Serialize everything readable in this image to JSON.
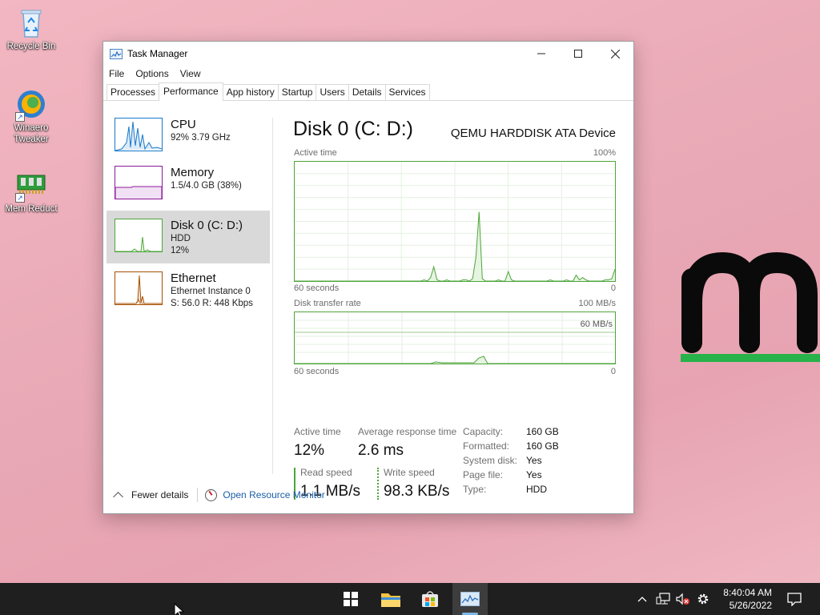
{
  "desktop": {
    "icons": [
      {
        "label": "Recycle Bin"
      },
      {
        "label": "Winaero Tweaker"
      },
      {
        "label": "Mem Reduct"
      }
    ]
  },
  "window": {
    "title": "Task Manager",
    "menu": [
      "File",
      "Options",
      "View"
    ],
    "tabs": [
      "Processes",
      "Performance",
      "App history",
      "Startup",
      "Users",
      "Details",
      "Services"
    ],
    "active_tab": "Performance"
  },
  "sidebar": {
    "items": [
      {
        "title": "CPU",
        "line1": "92%  3.79 GHz",
        "line2": "",
        "color": "#1979c9"
      },
      {
        "title": "Memory",
        "line1": "1.5/4.0 GB (38%)",
        "line2": "",
        "color": "#8b1a9c"
      },
      {
        "title": "Disk 0 (C: D:)",
        "line1": "HDD",
        "line2": "12%",
        "color": "#4da53a",
        "selected": true
      },
      {
        "title": "Ethernet",
        "line1": "Ethernet Instance 0",
        "line2": "S: 56.0  R: 448 Kbps",
        "color": "#a74f01"
      }
    ]
  },
  "detail": {
    "title": "Disk 0 (C: D:)",
    "device": "QEMU HARDDISK ATA Device",
    "active_graph": {
      "label": "Active time",
      "max": "100%",
      "time": "60 seconds",
      "min": "0"
    },
    "transfer_graph": {
      "label": "Disk transfer rate",
      "max": "100 MB/s",
      "line": "60 MB/s",
      "time": "60 seconds",
      "min": "0"
    },
    "stats": {
      "active_time_label": "Active time",
      "active_time": "12%",
      "avg_resp_label": "Average response time",
      "avg_resp": "2.6 ms",
      "read_label": "Read speed",
      "read": "1.1 MB/s",
      "write_label": "Write speed",
      "write": "98.3 KB/s"
    },
    "properties": [
      {
        "k": "Capacity:",
        "v": "160 GB"
      },
      {
        "k": "Formatted:",
        "v": "160 GB"
      },
      {
        "k": "System disk:",
        "v": "Yes"
      },
      {
        "k": "Page file:",
        "v": "Yes"
      },
      {
        "k": "Type:",
        "v": "HDD"
      }
    ]
  },
  "footer": {
    "fewer_details": "Fewer details",
    "resource_monitor": "Open Resource Monitor"
  },
  "taskbar": {
    "time": "8:40:04 AM",
    "date": "5/26/2022"
  },
  "chart_data": {
    "type": "line",
    "series": [
      {
        "values": [
          0,
          0,
          0,
          0,
          0,
          0,
          0,
          0,
          0,
          0,
          0,
          0,
          0,
          0,
          0,
          0,
          0,
          0,
          0,
          0,
          0,
          0,
          0,
          0,
          0,
          0,
          0,
          0,
          0,
          0,
          0,
          0,
          0,
          0,
          0,
          0,
          0,
          0,
          0,
          0,
          1,
          0,
          3,
          12,
          1,
          0,
          0,
          1,
          0,
          0,
          0,
          0,
          1,
          1,
          0,
          2,
          20,
          58,
          2,
          0,
          0,
          0,
          0,
          1,
          0,
          0,
          8,
          1,
          0,
          0,
          0,
          0,
          0,
          0,
          0,
          0,
          0,
          0,
          0,
          1,
          0,
          0,
          0,
          0,
          1,
          0,
          0,
          5,
          1,
          3,
          1,
          0,
          0,
          0,
          0,
          0,
          1,
          1,
          2,
          10
        ]
      }
    ],
    "ylim": [
      0,
      100
    ]
  }
}
